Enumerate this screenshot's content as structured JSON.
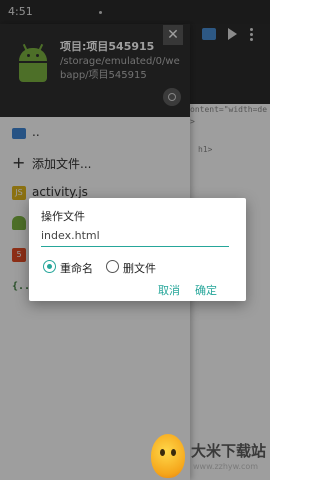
{
  "status_bar": {
    "time": "4:51"
  },
  "editor": {
    "code_lines": [
      "ontent=\"width=de",
      ">",
      "h1>"
    ]
  },
  "drawer": {
    "project_title": "项目:项目545915",
    "project_path": "/storage/emulated/0/webapp/项目545915",
    "items": [
      {
        "label": "..",
        "icon": "folder-icon"
      },
      {
        "label": "添加文件...",
        "icon": "plus-icon"
      },
      {
        "label": "activity.js",
        "icon": "js-file-icon"
      },
      {
        "label": "",
        "icon": "android-icon"
      },
      {
        "label": "",
        "icon": "html-file-icon"
      },
      {
        "label": "",
        "icon": "json-file-icon"
      }
    ]
  },
  "dialog": {
    "title": "操作文件",
    "input_value": "index.html",
    "options": [
      {
        "label": "重命名",
        "checked": true
      },
      {
        "label": "删文件",
        "checked": false
      }
    ],
    "cancel_label": "取消",
    "confirm_label": "确定"
  },
  "watermark": {
    "title": "大米下载站",
    "url": "www.zzhyw.com"
  },
  "colors": {
    "accent": "#26a69a",
    "header_bg": "#303030",
    "android_green": "#7cb342"
  }
}
